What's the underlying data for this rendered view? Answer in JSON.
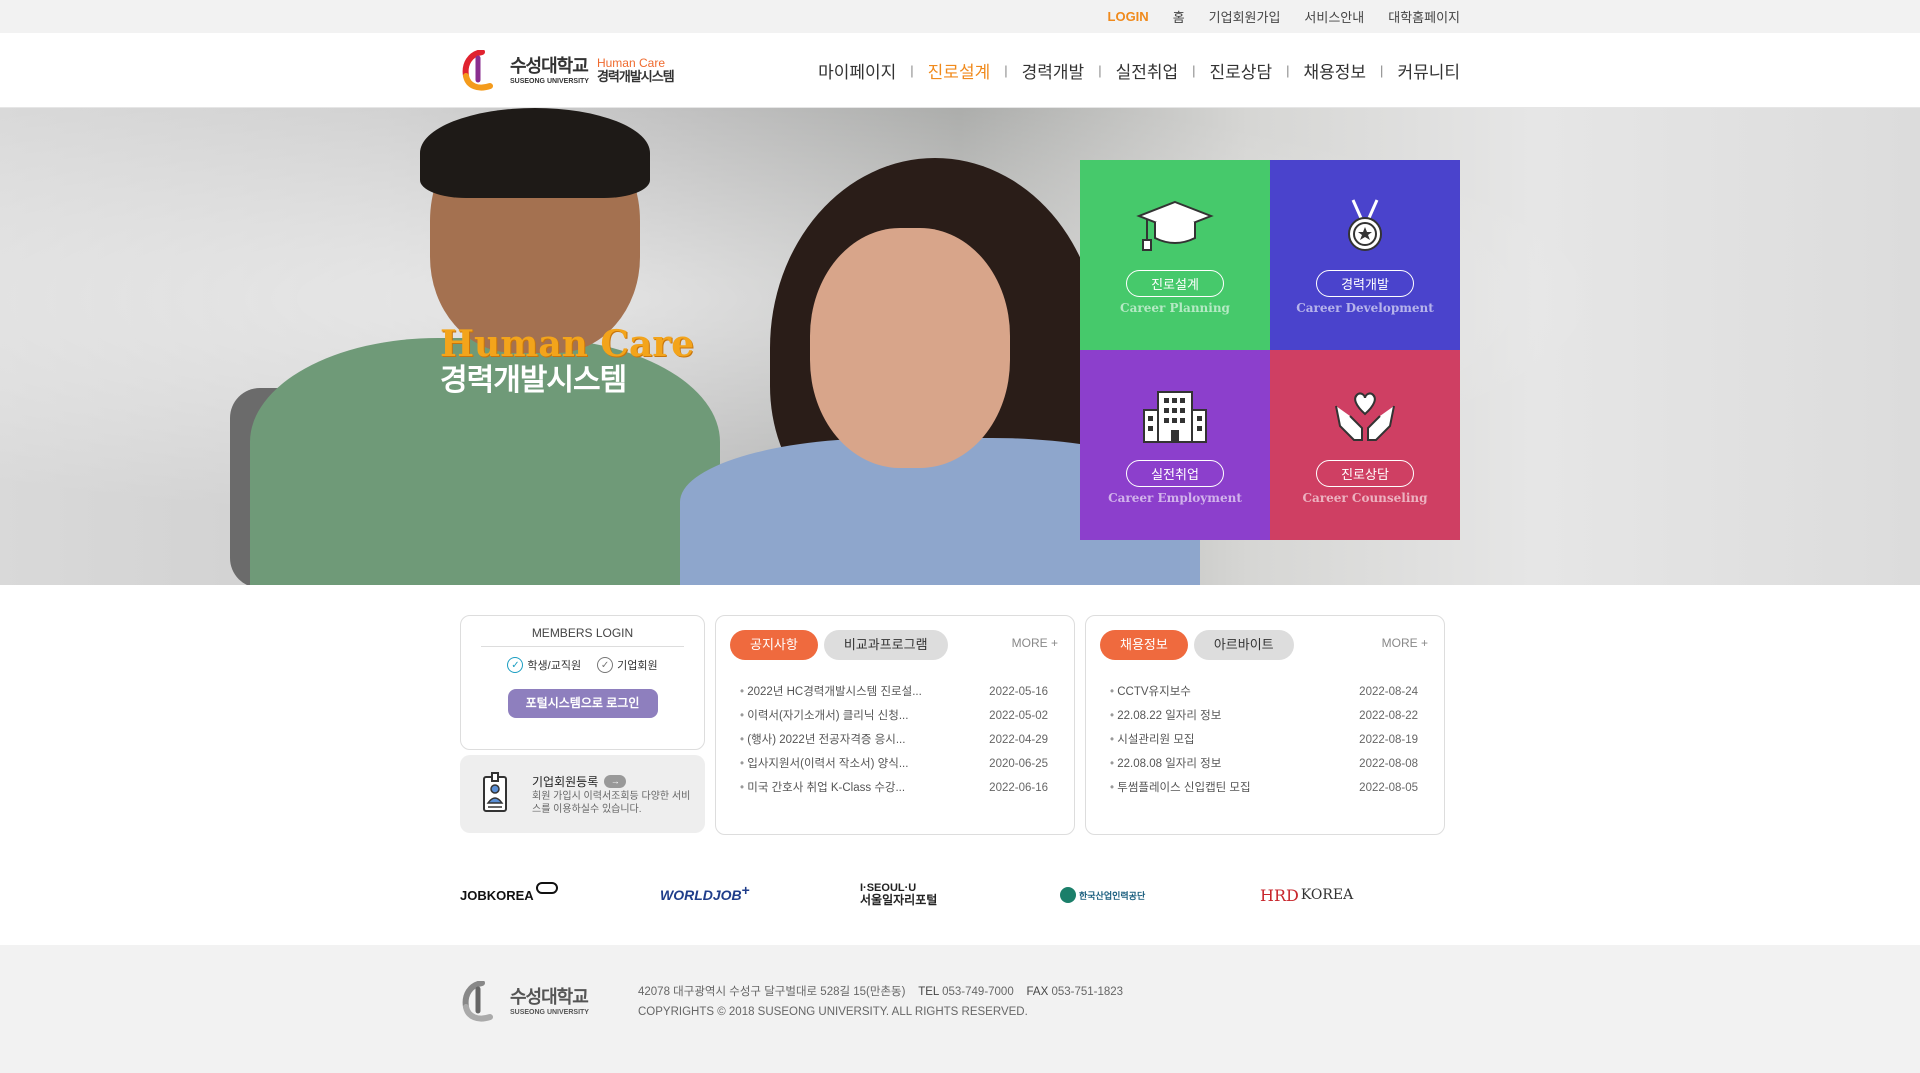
{
  "topbar": {
    "login": "LOGIN",
    "home": "홈",
    "corp_join": "기업회원가입",
    "service": "서비스안내",
    "univ_home": "대학홈페이지"
  },
  "logo": {
    "ko": "수성대학교",
    "en": "SUSEONG UNIVERSITY",
    "hc": "Human Care",
    "sys": "경력개발시스템"
  },
  "gnb": [
    "마이페이지",
    "진로설계",
    "경력개발",
    "실전취업",
    "진로상담",
    "채용정보",
    "커뮤니티"
  ],
  "hero": {
    "title_en": "Human Care",
    "title_ko": "경력개발시스템"
  },
  "tiles": [
    {
      "label": "진로설계",
      "en": "Career Planning",
      "color": "#46c96b",
      "icon": "graduation-cap-icon"
    },
    {
      "label": "경력개발",
      "en": "Career Development",
      "color": "#4a43cc",
      "icon": "medal-icon"
    },
    {
      "label": "실전취업",
      "en": "Career Employment",
      "color": "#8c3fcc",
      "icon": "building-icon"
    },
    {
      "label": "진로상담",
      "en": "Career Counseling",
      "color": "#cf3f63",
      "icon": "heart-hands-icon"
    }
  ],
  "login": {
    "title": "MEMBERS LOGIN",
    "student": "학생/교직원",
    "corp": "기업회원",
    "button": "포털시스템으로 로그인"
  },
  "corp_reg": {
    "title": "기업회원등록",
    "desc": "회원 가입시 이력서조회등 다양한 서비스를 이용하실수 있습니다."
  },
  "board1": {
    "tabs": [
      "공지사항",
      "비교과프로그램"
    ],
    "more": "MORE +",
    "rows": [
      {
        "title": "2022년 HC경력개발시스템 진로설...",
        "date": "2022-05-16"
      },
      {
        "title": "이력서(자기소개서) 클리닉 신청...",
        "date": "2022-05-02"
      },
      {
        "title": "(행사) 2022년 전공자격증 응시...",
        "date": "2022-04-29"
      },
      {
        "title": "입사지원서(이력서 작소서) 양식...",
        "date": "2020-06-25"
      },
      {
        "title": "미국 간호사 취업 K-Class 수강...",
        "date": "2022-06-16"
      }
    ]
  },
  "board2": {
    "tabs": [
      "채용정보",
      "아르바이트"
    ],
    "more": "MORE +",
    "rows": [
      {
        "title": "CCTV유지보수",
        "date": "2022-08-24"
      },
      {
        "title": "22.08.22 일자리 정보",
        "date": "2022-08-22"
      },
      {
        "title": "시설관리원 모집",
        "date": "2022-08-19"
      },
      {
        "title": "22.08.08 일자리 정보",
        "date": "2022-08-08"
      },
      {
        "title": "투썸플레이스 신입캡틴 모집",
        "date": "2022-08-05"
      }
    ]
  },
  "partners": {
    "jobkorea": "JOBKOREA",
    "worldjob": "WORLDJOB",
    "seoul_top": "I·SEOUL·U",
    "seoul_bottom": "서울일자리포털",
    "hrdkorea_org": "한국산업인력공단",
    "hrd": "HRD",
    "korea": "KOREA"
  },
  "footer": {
    "address": "42078 대구광역시 수성구 달구벌대로 528길 15(만촌동)",
    "tel_label": "TEL",
    "tel": "053-749-7000",
    "fax_label": "FAX",
    "fax": "053-751-1823",
    "copyright": "COPYRIGHTS © 2018 SUSEONG UNIVERSITY. ALL RIGHTS RESERVED."
  }
}
